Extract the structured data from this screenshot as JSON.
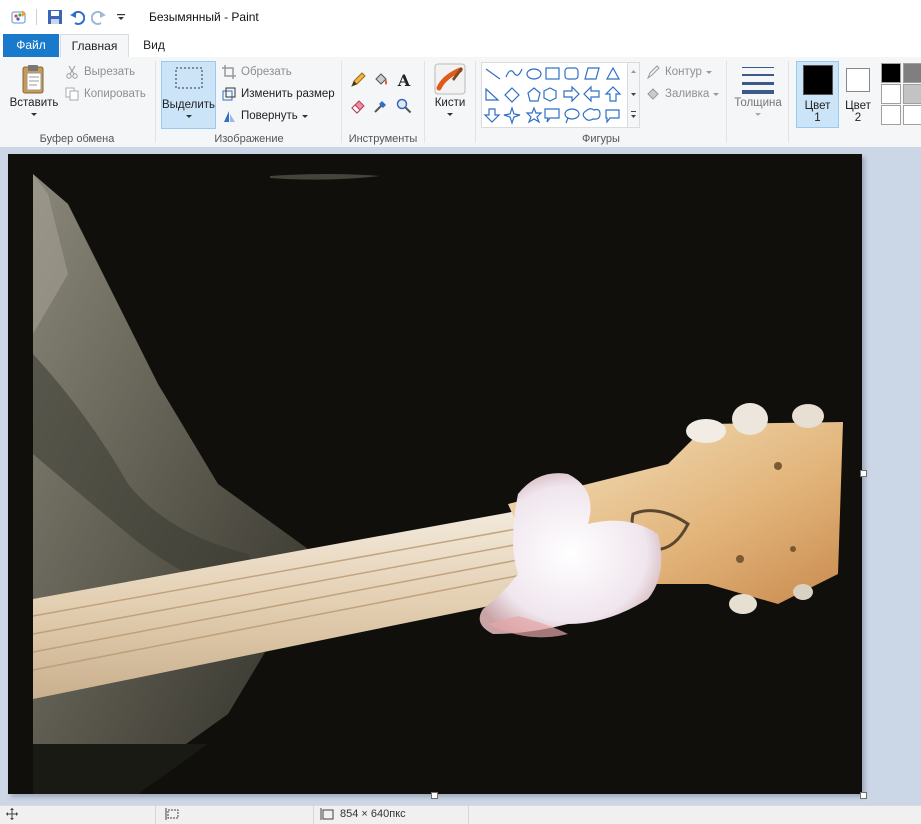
{
  "window": {
    "title": "Безымянный - Paint"
  },
  "tabs": {
    "file": "Файл",
    "home": "Главная",
    "view": "Вид"
  },
  "clipboard": {
    "paste": "Вставить",
    "cut": "Вырезать",
    "copy": "Копировать",
    "group": "Буфер обмена"
  },
  "image": {
    "select": "Выделить",
    "crop": "Обрезать",
    "resize": "Изменить размер",
    "rotate": "Повернуть",
    "group": "Изображение"
  },
  "tools": {
    "group": "Инструменты",
    "brushes": "Кисти"
  },
  "shapes": {
    "group": "Фигуры",
    "outline": "Контур",
    "fill": "Заливка"
  },
  "size": {
    "label": "Толщина"
  },
  "colors": {
    "color1_label": "Цвет",
    "color1_num": "1",
    "color2_label": "Цвет",
    "color2_num": "2",
    "color1": "#000000",
    "color2": "#ffffff",
    "palette": [
      "#000000",
      "#7f7f7f",
      "#ffffff",
      "#c3c3c3",
      "#ffffff",
      "#ffffff"
    ]
  },
  "statusbar": {
    "canvas_size": "854 × 640пкс"
  },
  "icons": [
    "paint-app-icon",
    "save-icon",
    "undo-icon",
    "redo-icon",
    "customize-arrow-icon",
    "paste-icon",
    "cut-icon",
    "copy-icon",
    "select-icon",
    "crop-icon",
    "resize-icon",
    "rotate-icon",
    "pencil-icon",
    "fill-bucket-icon",
    "text-icon",
    "eraser-icon",
    "color-picker-icon",
    "magnifier-icon",
    "brush-icon",
    "outline-icon",
    "fill-icon",
    "size-icon",
    "move-cursor-icon",
    "selection-size-icon",
    "canvas-size-icon"
  ]
}
